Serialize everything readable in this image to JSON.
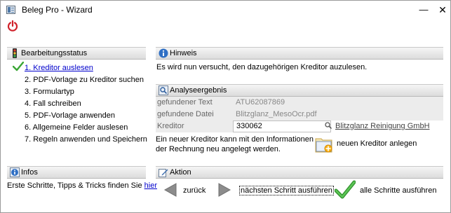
{
  "window": {
    "title": "Beleg Pro - Wizard",
    "minimize_glyph": "—",
    "close_glyph": "✕"
  },
  "toolbar": {
    "power_icon": "power-icon",
    "power_color": "#d0212a"
  },
  "status_panel": {
    "title": "Bearbeitungsstatus",
    "steps": [
      "1. Kreditor auslesen",
      "2. PDF-Vorlage zu Kreditor suchen",
      "3. Formulartyp",
      "4. Fall schreiben",
      "5. PDF-Vorlage anwenden",
      "6. Allgemeine Felder auslesen",
      "7. Regeln anwenden und Speichern"
    ],
    "active_step": 0
  },
  "hinweis": {
    "title": "Hinweis",
    "text": "Es wird nun versucht, den dazugehörigen Kreditor auzulesen."
  },
  "analyse": {
    "title": "Analyseergebnis",
    "rows": [
      {
        "label": "gefundener Text",
        "value": "ATU62087869"
      },
      {
        "label": "gefundene Datei",
        "value": "Blitzglanz_MesoOcr.pdf"
      },
      {
        "label": "Kreditor",
        "value": "330062",
        "link": "Blitzglanz Reinigung GmbH"
      }
    ],
    "info_text": "Ein neuer Kreditor kann mit den Informationen der Rechnung neu angelegt werden.",
    "new_kreditor_label": "neuen Kreditor anlegen"
  },
  "infos": {
    "title": "Infos",
    "text": "Erste Schritte, Tipps & Tricks finden Sie ",
    "link": "hier"
  },
  "aktion": {
    "title": "Aktion",
    "back_label": "zurück",
    "next_label": "nächsten Schritt ausführen",
    "all_label": "alle Schritte ausführen"
  },
  "colors": {
    "accent_link": "#0000cc",
    "check_green": "#3aa635",
    "header_bg": "#dcdcdc"
  }
}
